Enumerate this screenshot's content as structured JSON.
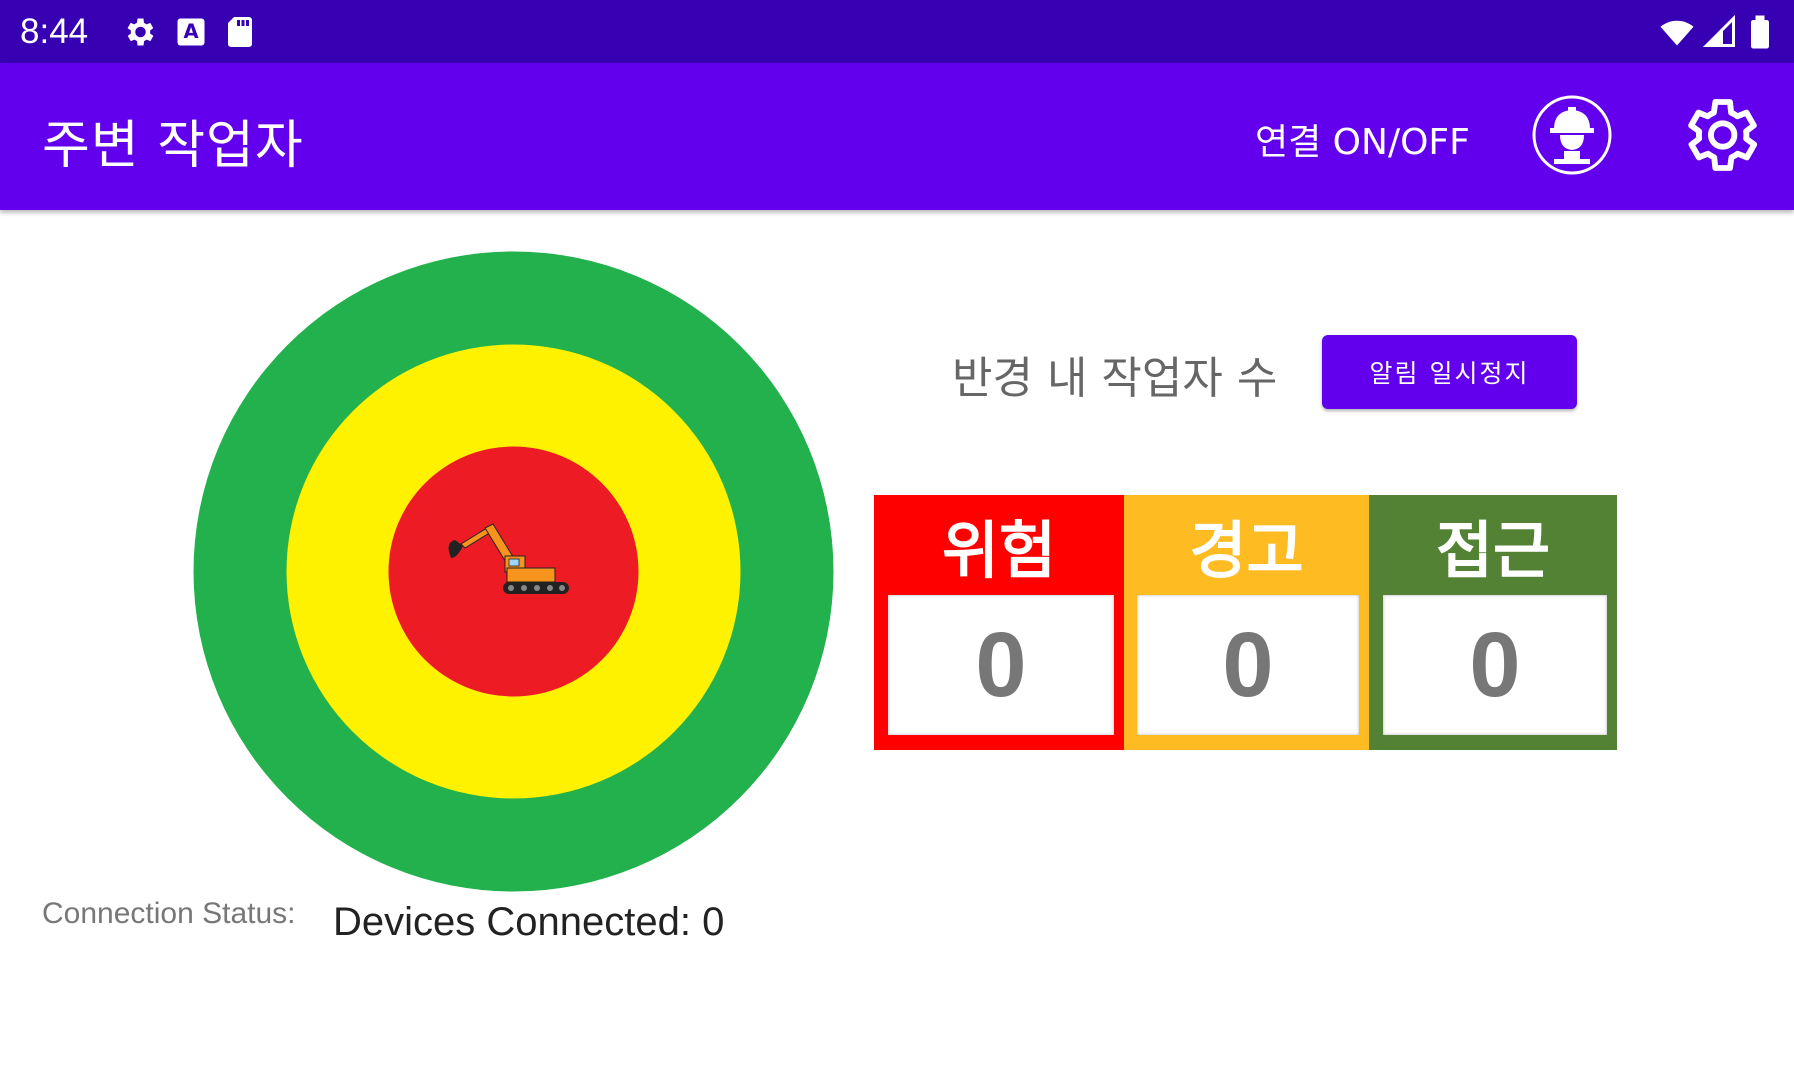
{
  "status_bar": {
    "time": "8:44",
    "icons": [
      "settings-gear-icon",
      "keyboard-a-icon",
      "sd-card-icon",
      "wifi-icon",
      "cellular-signal-icon",
      "battery-icon"
    ]
  },
  "app_bar": {
    "title": "주변 작업자",
    "connection_toggle": "연결 ON/OFF",
    "icons": [
      "worker-helmet-icon",
      "settings-gear-icon"
    ]
  },
  "radius_view": {
    "zones": [
      "red",
      "yellow",
      "green"
    ],
    "center_icon": "excavator-icon"
  },
  "worker_count": {
    "label": "반경 내 작업자 수",
    "pause_button": "알림 일시정지",
    "levels": [
      {
        "title": "위험",
        "count": "0",
        "color": "#ff0000"
      },
      {
        "title": "경고",
        "count": "0",
        "color": "#ffbb22"
      },
      {
        "title": "접근",
        "count": "0",
        "color": "#548235"
      }
    ]
  },
  "connection": {
    "label": "Connection Status:",
    "value": "Devices Connected: 0"
  },
  "colors": {
    "status_bar": "#3700b3",
    "app_bar": "#6200ee",
    "zone_red": "#ed1c24",
    "zone_yellow": "#fff200",
    "zone_green": "#22b14c"
  }
}
